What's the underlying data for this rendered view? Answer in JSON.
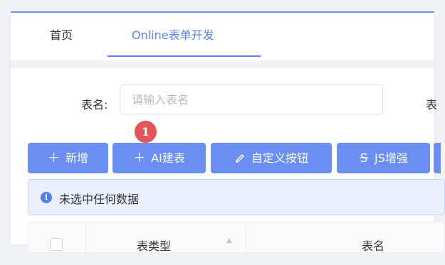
{
  "tabs": [
    {
      "label": "首页"
    },
    {
      "label": "Online表单开发"
    }
  ],
  "search": {
    "table_name_label": "表名:",
    "table_name_placeholder": "请输入表名",
    "next_label_partial": "表"
  },
  "toolbar": {
    "add_label": "新增",
    "ai_label": "AI建表",
    "custom_button_label": "自定义按钮",
    "js_label": "JS增强"
  },
  "badge": {
    "value": "1"
  },
  "alert": {
    "text": "未选中任何数据"
  },
  "table": {
    "columns": [
      "表类型",
      "表名"
    ]
  },
  "colors": {
    "primary": "#6a8ef3",
    "active_tab": "#5b83f0",
    "badge": "#e4555a",
    "alert_bg": "#eaf1fd"
  },
  "icons": {
    "add": "plus-icon",
    "ai": "plus-icon",
    "custom": "pen-icon",
    "js": "strikethrough-icon",
    "alert": "info-icon"
  }
}
